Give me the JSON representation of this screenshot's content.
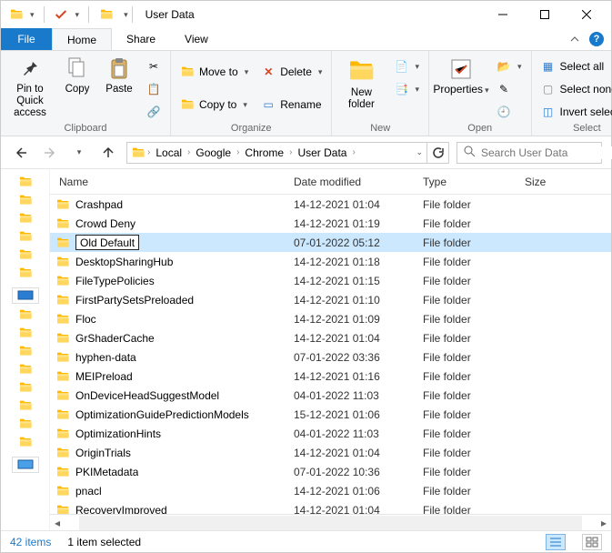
{
  "window": {
    "title": "User Data"
  },
  "tabs": {
    "file": "File",
    "home": "Home",
    "share": "Share",
    "view": "View"
  },
  "ribbon": {
    "pin_to_quick": "Pin to Quick access",
    "copy": "Copy",
    "paste": "Paste",
    "cut": "Cut",
    "copy_path": "Copy path",
    "paste_shortcut": "Paste shortcut",
    "move_to": "Move to",
    "copy_to": "Copy to",
    "delete": "Delete",
    "rename": "Rename",
    "new_folder": "New folder",
    "new_item": "New item",
    "easy_access": "Easy access",
    "properties": "Properties",
    "open_menu": "Open",
    "edit": "Edit",
    "history": "History",
    "select_all": "Select all",
    "select_none": "Select none",
    "invert_selection": "Invert selection",
    "group_clipboard": "Clipboard",
    "group_organize": "Organize",
    "group_new": "New",
    "group_open": "Open",
    "group_select": "Select"
  },
  "breadcrumb": [
    "Local",
    "Google",
    "Chrome",
    "User Data"
  ],
  "search": {
    "placeholder": "Search User Data"
  },
  "columns": {
    "name": "Name",
    "date": "Date modified",
    "type": "Type",
    "size": "Size"
  },
  "items": [
    {
      "name": "Crashpad",
      "date": "14-12-2021 01:04",
      "type": "File folder",
      "selected": false,
      "editing": false
    },
    {
      "name": "Crowd Deny",
      "date": "14-12-2021 01:19",
      "type": "File folder",
      "selected": false,
      "editing": false
    },
    {
      "name": "Old Default",
      "date": "07-01-2022 05:12",
      "type": "File folder",
      "selected": true,
      "editing": true
    },
    {
      "name": "DesktopSharingHub",
      "date": "14-12-2021 01:18",
      "type": "File folder",
      "selected": false,
      "editing": false
    },
    {
      "name": "FileTypePolicies",
      "date": "14-12-2021 01:15",
      "type": "File folder",
      "selected": false,
      "editing": false
    },
    {
      "name": "FirstPartySetsPreloaded",
      "date": "14-12-2021 01:10",
      "type": "File folder",
      "selected": false,
      "editing": false
    },
    {
      "name": "Floc",
      "date": "14-12-2021 01:09",
      "type": "File folder",
      "selected": false,
      "editing": false
    },
    {
      "name": "GrShaderCache",
      "date": "14-12-2021 01:04",
      "type": "File folder",
      "selected": false,
      "editing": false
    },
    {
      "name": "hyphen-data",
      "date": "07-01-2022 03:36",
      "type": "File folder",
      "selected": false,
      "editing": false
    },
    {
      "name": "MEIPreload",
      "date": "14-12-2021 01:16",
      "type": "File folder",
      "selected": false,
      "editing": false
    },
    {
      "name": "OnDeviceHeadSuggestModel",
      "date": "04-01-2022 11:03",
      "type": "File folder",
      "selected": false,
      "editing": false
    },
    {
      "name": "OptimizationGuidePredictionModels",
      "date": "15-12-2021 01:06",
      "type": "File folder",
      "selected": false,
      "editing": false
    },
    {
      "name": "OptimizationHints",
      "date": "04-01-2022 11:03",
      "type": "File folder",
      "selected": false,
      "editing": false
    },
    {
      "name": "OriginTrials",
      "date": "14-12-2021 01:04",
      "type": "File folder",
      "selected": false,
      "editing": false
    },
    {
      "name": "PKIMetadata",
      "date": "07-01-2022 10:36",
      "type": "File folder",
      "selected": false,
      "editing": false
    },
    {
      "name": "pnacl",
      "date": "14-12-2021 01:06",
      "type": "File folder",
      "selected": false,
      "editing": false
    },
    {
      "name": "RecoveryImproved",
      "date": "14-12-2021 01:04",
      "type": "File folder",
      "selected": false,
      "editing": false
    }
  ],
  "status": {
    "count": "42 items",
    "selection": "1 item selected"
  }
}
